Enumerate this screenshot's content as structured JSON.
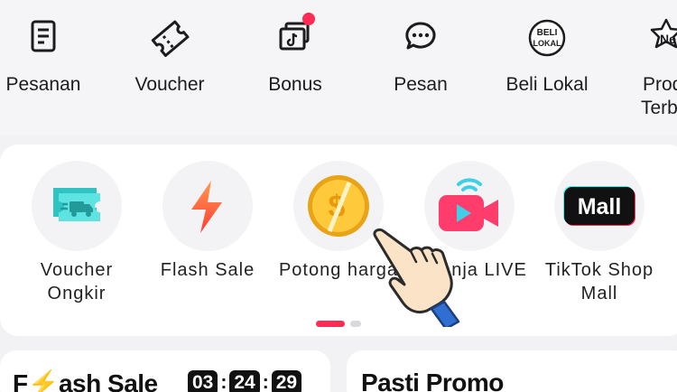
{
  "top_row": {
    "items": [
      {
        "label": "Pesanan",
        "icon": "document-list-icon"
      },
      {
        "label": "Voucher",
        "icon": "ticket-icon"
      },
      {
        "label": "Bonus",
        "icon": "tiktok-cards-icon"
      },
      {
        "label": "Pesan",
        "icon": "chat-bubble-icon"
      },
      {
        "label": "Beli Lokal",
        "icon": "beli-lokal-badge-icon"
      },
      {
        "label": "Prod",
        "label2": "Terb",
        "icon": "new-star-icon"
      }
    ],
    "new_badge": "Ne",
    "beli_badge_top": "BELI",
    "beli_badge_bottom": "LOKAL"
  },
  "shortcuts": {
    "items": [
      {
        "line1": "Voucher",
        "line2": "Ongkir",
        "icon": "delivery-voucher-icon"
      },
      {
        "line1": "Flash Sale",
        "line2": "",
        "icon": "lightning-icon"
      },
      {
        "line1": "Potong harga",
        "line2": "",
        "icon": "coin-icon"
      },
      {
        "line1": "Belanja LIVE",
        "line2": "",
        "icon": "live-camera-icon"
      },
      {
        "line1": "TikTok Shop",
        "line2": "Mall",
        "icon": "mall-badge-icon"
      }
    ],
    "mall_badge": "Mall",
    "pager": {
      "active": 0,
      "count": 2
    }
  },
  "flash_sale": {
    "title_prefix": "F",
    "title_rest": "ash Sale",
    "timer": {
      "hours": "03",
      "minutes": "24",
      "seconds": "29"
    }
  },
  "promo": {
    "title": "Pasti Promo"
  },
  "colors": {
    "accent": "#fe2c55",
    "text": "#1c1c1e",
    "card": "#ffffff",
    "background": "#f2f2f4"
  }
}
